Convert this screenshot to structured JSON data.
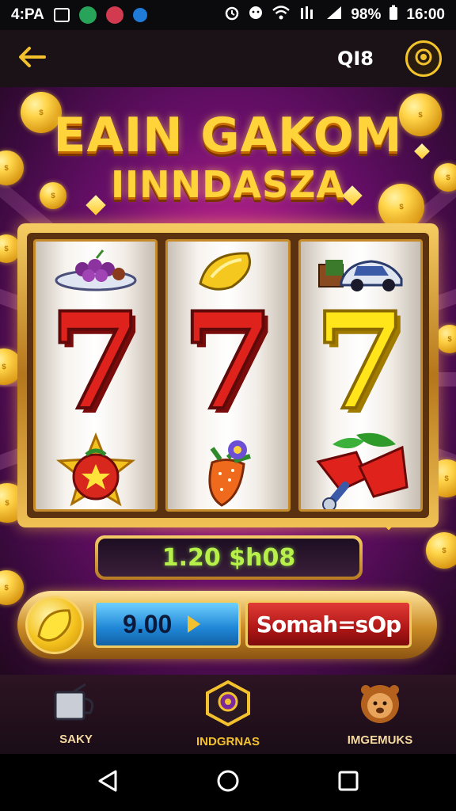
{
  "status_bar": {
    "time": "4:PA",
    "battery": "98%",
    "clock": "16:00"
  },
  "header": {
    "id_text": "QI8"
  },
  "game": {
    "title_line1": "EAIN GAKOM",
    "title_line2": "IINNDASZA",
    "reels": [
      {
        "top": "grapes-plate",
        "middle": "7",
        "middle_color": "red",
        "bottom": "tomato-star"
      },
      {
        "top": "lemon",
        "middle": "7",
        "middle_color": "red",
        "bottom": "strawberry-flower"
      },
      {
        "top": "race-car",
        "middle": "7",
        "middle_color": "yellow",
        "bottom": "red-kite"
      }
    ],
    "win_display": "1.20 $h08",
    "bet_value": "9.00",
    "spin_label": "Somah=sOp"
  },
  "bottom_nav": {
    "items": [
      {
        "label": "SAKY",
        "icon": "mug-icon"
      },
      {
        "label": "INDGRNAS",
        "icon": "badge-icon"
      },
      {
        "label": "IMGEMUKS",
        "icon": "lion-icon"
      }
    ]
  },
  "colors": {
    "gold": "#f3c12e",
    "background_magenta": "#c0258f",
    "seven_red": "#e0221c",
    "seven_yellow": "#ffe51a",
    "win_green": "#b8f04a",
    "bet_blue": "#1f86d6",
    "spin_red": "#b01717"
  }
}
